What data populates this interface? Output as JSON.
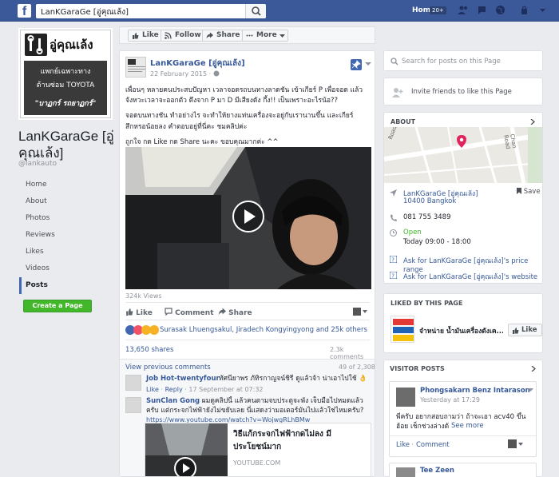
{
  "topbar": {
    "search_text": "LanKGaraGe [อู่คุณเล้ง]",
    "home_label": "Home",
    "home_badge": "20+"
  },
  "left": {
    "profile_title": "อู่คุณเล้ง",
    "profile_line1": "แพกย์เฉพาะทาง",
    "profile_line2": "ด้านซ่อม TOYOTA",
    "profile_line3": "\"บาฏกร์ รถยาฏกร์\"",
    "page_name": "LanKGaraGe [อู่คุณเล้ง]",
    "handle": "@lankauto",
    "nav": [
      {
        "label": "Home"
      },
      {
        "label": "About"
      },
      {
        "label": "Photos"
      },
      {
        "label": "Reviews"
      },
      {
        "label": "Likes"
      },
      {
        "label": "Videos"
      },
      {
        "label": "Posts"
      }
    ],
    "create_page": "Create a Page"
  },
  "actionbar": {
    "like": "Like",
    "follow": "Follow",
    "share": "Share",
    "more": "More"
  },
  "post": {
    "author": "LanKGaraGe [อู่คุณเล้ง]",
    "date": "22 February 2015 ·",
    "para1": "เพื่อนๆ หลายคนประสบปัญหา เวลาจอดรถบนทางลาดชัน เข้าเกียร์ P เพื่อจอด แล้ว จังหวะเวลาจะออกตัว ดึงจาก P มา D มีเสียงดัง กึ้ง!! เป็นเพราะอะไรน้อ??",
    "para2": "จอดบนทางชัน ทำอย่างไร จะทำให้ยางแท่นเครื่องจะอยู่กับเรานานขึ้น และเกียร์ สึกหรอน้อยลง คำตอบอยู่ที่นี่คะ ชมคลิปค่ะ",
    "para3": "ถูกใจ กด Like กด Share นะคะ ขอบคุณมากค่ะ ^^",
    "views": "324k Views",
    "like": "Like",
    "comment": "Comment",
    "share": "Share",
    "reactions_text": "Surasak Lhuengsakul, Jiradech Kongyingyong and 25k others",
    "shares": "13,650 shares",
    "comments_count": "2.3k comments",
    "view_previous": "View previous comments",
    "page_count": "49 of 2,308",
    "comments": [
      {
        "name": "Job Hot-twentyfour",
        "text": "ทัศนียาพร ภัทิรกาญจน์ชิรี ดูแล้วจ้า น่าเอาไปใช้ 👌",
        "meta_like": "Like",
        "meta_reply": "Reply",
        "meta_time": "17 September at 07:32"
      },
      {
        "name": "SunClan Gong",
        "text": "ผมดูคลิปนี้ แล้วคนตามจบประตูจะพัง เจ็บมือไปหมดแล้วครับ แต่กระจกไฟฟ้ายังไม่ขยับเลย นี่แสดงว่ามอเตอร์มันไปแล้วใช่ไหมครับ?",
        "url": "https://www.youtube.com/watch?v=WojwgRLhBMw"
      }
    ],
    "link_card": {
      "title": "วิธีแก้กระจกไฟฟ้ากดไม่ลง มีประโยชน์มาก",
      "domain": "YOUTUBE.COM"
    }
  },
  "right": {
    "search_placeholder": "Search for posts on this Page",
    "invite": "Invite friends to like this Page",
    "about_header": "ABOUT",
    "map_labels": [
      "Road",
      "Chan Road"
    ],
    "address_name": "LanKGaraGe [อู่คุณเล้ง]",
    "address_city": "10400 Bangkok",
    "save": "Save",
    "phone": "081 755 3489",
    "open": "Open",
    "hours": "Today 09:00 - 18:00",
    "price_range": "Ask for LanKGaraGe [อู่คุณเล้ง]'s price range",
    "website": "Ask for LanKGaraGe [อู่คุณเล้ง]'s website",
    "liked_header": "LIKED BY THIS PAGE",
    "liked_name": "จำหน่าย น้ำมันเครื่องดังเค...",
    "liked_like": "Like",
    "visitor_header": "VISITOR POSTS",
    "visitor_name": "Phongsakarn Benz Intarason",
    "visitor_time": "Yesterday at 17:29",
    "visitor_text": "พี่ครับ อยากสอบถามว่า ถ้าจะเอา acv40 ขึ้นฮ้อย เช็กช่วงล่างด้านหน้า ร...",
    "visitor_see_more": "See more",
    "visitor_like": "Like",
    "visitor_comment": "Comment",
    "visitor2_name": "Tee Zeen"
  }
}
